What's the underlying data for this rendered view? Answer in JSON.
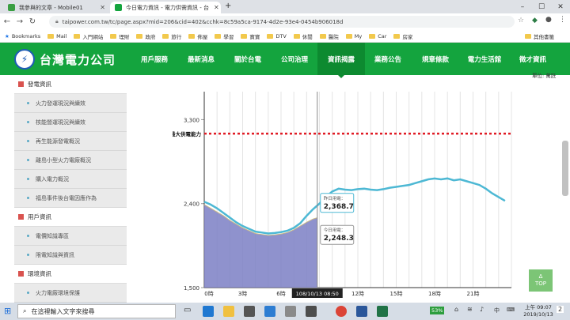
{
  "browser": {
    "tabs": [
      {
        "title": "我參與的文章 - Mobile01",
        "fav_color": "#3a9f43"
      },
      {
        "title": "今日電力資訊 - 電力供需資訊 - 台",
        "fav_color": "#14a43e"
      }
    ],
    "new_tab": "+",
    "url": "taipower.com.tw/tc/page.aspx?mid=206&cid=402&cchk=8c59a5ca-9174-4d2e-93e4-0454b906018d",
    "bookmarks": [
      "Bookmarks",
      "Mail",
      "入門網站",
      "理財",
      "政府",
      "旅行",
      "佈屋",
      "學習",
      "寶寶",
      "DTV",
      "休閒",
      "醫院",
      "My",
      "Car",
      "房家"
    ],
    "other_bookmarks": "其他書籤"
  },
  "site": {
    "brand": "台灣電力公司",
    "menu": [
      "用戶服務",
      "最新消息",
      "關於台電",
      "公司治理",
      "資訊揭露",
      "業務公告",
      "規章條款",
      "電力生活館",
      "徵才資訊"
    ],
    "active_menu": 4
  },
  "sidebar": {
    "groups": [
      {
        "label": "發電資訊",
        "items": [
          "火力發運現況與續效",
          "核能營運現況與續效",
          "再生能源發電概況",
          "離島小型火力電廠概況",
          "購入電力概況",
          "福島事件後台電因應作為"
        ]
      },
      {
        "label": "用戶資訊",
        "items": [
          "電價知識專區",
          "限電知識與資訊"
        ]
      },
      {
        "label": "環境資訊",
        "items": [
          "火力電廠環境保護"
        ]
      }
    ]
  },
  "chart_data": {
    "type": "line",
    "unit_label": "單位: 萬瓩",
    "yticks": [
      "1,500",
      "2,400",
      "3,300"
    ],
    "ylim": [
      1500,
      3600
    ],
    "xticks": [
      "0時",
      "3時",
      "6時",
      "9時",
      "12時",
      "15時",
      "18時",
      "21時"
    ],
    "xlim": [
      0,
      24
    ],
    "max_supply": {
      "label": "最大供電能力",
      "value": 3150
    },
    "cursor_label": "108/10/13 08:50",
    "cursor_x": 8.83,
    "tooltip": [
      {
        "label": "昨日用電：",
        "value": "2,368.7"
      },
      {
        "label": "今日用電：",
        "value": "2,248.3"
      }
    ],
    "series": [
      {
        "name": "昨日用電",
        "color": "#4db8d4",
        "x": [
          0,
          0.5,
          1,
          1.5,
          2,
          2.5,
          3,
          3.5,
          4,
          4.5,
          5,
          5.5,
          6,
          6.5,
          7,
          7.5,
          8,
          8.5,
          9,
          9.5,
          10,
          10.5,
          11,
          11.5,
          12,
          12.5,
          13,
          13.5,
          14,
          14.5,
          15,
          15.5,
          16,
          16.5,
          17,
          17.5,
          18,
          18.5,
          19,
          19.5,
          20,
          20.5,
          21,
          21.5,
          22,
          22.5,
          23,
          23.5
        ],
        "y": [
          2420,
          2390,
          2350,
          2300,
          2250,
          2200,
          2160,
          2130,
          2100,
          2090,
          2080,
          2085,
          2095,
          2110,
          2140,
          2190,
          2270,
          2340,
          2400,
          2470,
          2530,
          2560,
          2550,
          2545,
          2555,
          2560,
          2550,
          2545,
          2555,
          2570,
          2580,
          2590,
          2600,
          2620,
          2640,
          2660,
          2670,
          2660,
          2670,
          2650,
          2660,
          2640,
          2620,
          2600,
          2560,
          2510,
          2470,
          2430
        ]
      },
      {
        "name": "今日用電",
        "color": "#7b7fc4",
        "x": [
          0,
          0.5,
          1,
          1.5,
          2,
          2.5,
          3,
          3.5,
          4,
          4.5,
          5,
          5.5,
          6,
          6.5,
          7,
          7.5,
          8,
          8.5,
          8.83
        ],
        "y": [
          2390,
          2350,
          2310,
          2270,
          2220,
          2180,
          2140,
          2110,
          2080,
          2070,
          2060,
          2065,
          2075,
          2090,
          2120,
          2160,
          2200,
          2235,
          2248
        ]
      }
    ]
  },
  "to_top": [
    "Δ",
    "TOP"
  ],
  "taskbar": {
    "search": "在這裡輸入文字來搜尋",
    "battery": "53%",
    "time": "上午 09:07",
    "date": "2019/10/13",
    "notif": "2"
  }
}
